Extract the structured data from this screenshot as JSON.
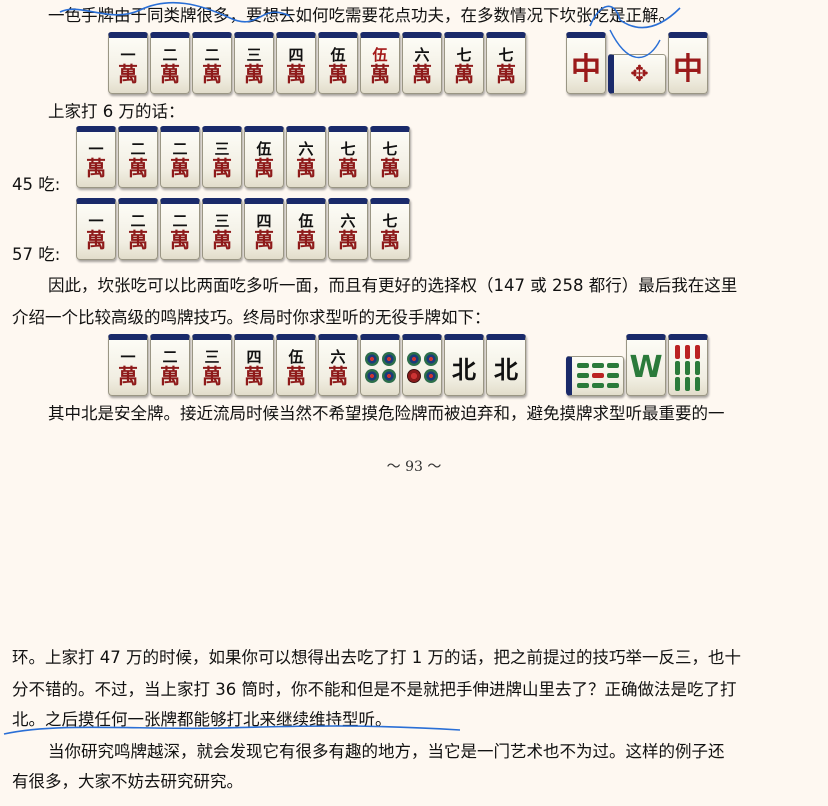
{
  "paragraphs": {
    "p1": "一色手牌由于同类牌很多，要想去如何吃需要花点功夫，在多数情况下坎张吃是正解。",
    "p2": "上家打 6 万的话：",
    "label45": "45 吃:",
    "label57": "57 吃:",
    "p3a": "因此，坎张吃可以比两面吃多听一面，而且有更好的选择权（147 或 258 都行）最后我在这里",
    "p3b": "介绍一个比较高级的鸣牌技巧。终局时你求型听的无役手牌如下：",
    "p4": "其中北是安全牌。接近流局时候当然不希望摸危险牌而被迫弃和，避免摸牌求型听最重要的一",
    "page_number": "～ 93 ～",
    "p5a": "环。上家打 47 万的时候，如果你可以想得出去吃了打 1 万的话，把之前提过的技巧举一反三，也十",
    "p5b": "分不错的。不过，当上家打 36 筒时，你不能和但是不是就把手伸进牌山里去了？正确做法是吃了打",
    "p5c": "北。之后摸任何一张牌都能够打北来继续维持型听。",
    "p6a": "当你研究鸣牌越深，就会发现它有很多有趣的地方，当它是一门艺术也不为过。这样的例子还",
    "p6b": "有很多，大家不妨去研究研究。"
  },
  "tiles": {
    "wan_char": "萬",
    "row1_hand": [
      "一",
      "二",
      "二",
      "三",
      "四",
      "伍",
      "伍",
      "六",
      "七",
      "七"
    ],
    "row1_meld": [
      "中",
      "",
      "中"
    ],
    "row2": [
      "一",
      "二",
      "二",
      "三",
      "伍",
      "六",
      "七",
      "七"
    ],
    "row3": [
      "一",
      "二",
      "二",
      "三",
      "四",
      "伍",
      "六",
      "七"
    ],
    "row4_hand": [
      "一",
      "二",
      "三",
      "四",
      "伍",
      "六"
    ],
    "row4_honors": [
      "北",
      "北"
    ]
  },
  "colors": {
    "background": "#fef8f1",
    "tile_back": "#1a2a6a",
    "wan_red": "#8e1a1a",
    "scribble_blue": "#2a6fd6"
  }
}
